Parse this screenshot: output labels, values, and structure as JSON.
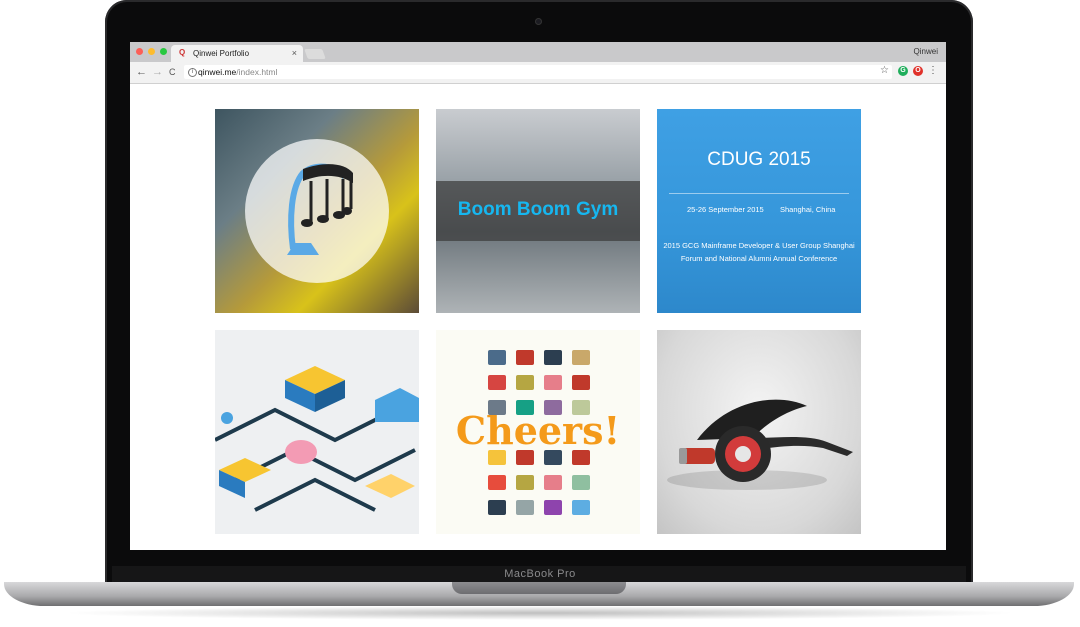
{
  "browser": {
    "tab_title": "Qinwei Portfolio",
    "tab_close": "×",
    "favicon": "Q",
    "profile_name": "Qinwei",
    "url_host": "qinwei.me",
    "url_path": "/index.html",
    "back_icon": "←",
    "forward_icon": "→",
    "reload_icon": "C",
    "star_icon": "☆",
    "menu_icon": "⋮",
    "ext1_letter": "G",
    "ext2_letter": "O"
  },
  "device": {
    "brand": "MacBook Pro"
  },
  "portfolio": {
    "tiles": [
      {
        "name": "harp-music-project",
        "icon": "harp-music-icon"
      },
      {
        "name": "boom-boom-gym",
        "label": "Boom Boom Gym"
      },
      {
        "name": "cdug-2015",
        "title": "CDUG 2015",
        "date": "25-26 September 2015",
        "place": "Shanghai, China",
        "desc": "2015 GCG Mainframe Developer & User Group Shanghai Forum and National Alumni Annual Conference"
      },
      {
        "name": "isometric-city-illustration"
      },
      {
        "name": "cheers-mugs",
        "label": "Cheers!"
      },
      {
        "name": "electric-scooter-render"
      }
    ]
  },
  "colors": {
    "accent_blue": "#16b7f0",
    "cdug_blue": "#3596da",
    "cheers_orange": "#f49a1a"
  }
}
